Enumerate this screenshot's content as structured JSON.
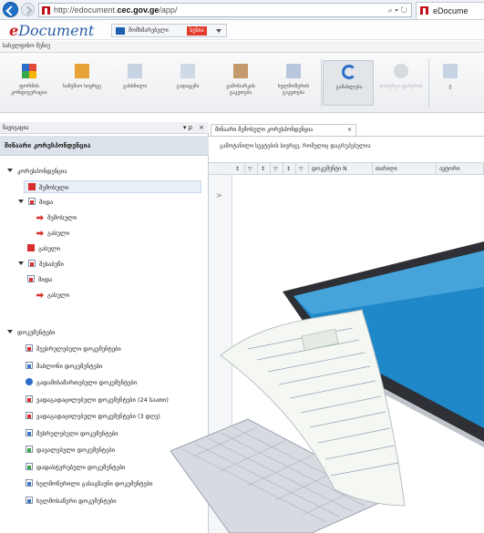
{
  "browser": {
    "url_prefix": "http://edocument.",
    "url_host": "cec.gov.ge",
    "url_suffix": "/app/",
    "tools": "⌕ ▾ ↻",
    "tab_title": "eDocume"
  },
  "app": {
    "logo_e": "e",
    "logo_rest": "Document",
    "language_label": "მომხმარებელი",
    "language_badge": "სესია",
    "menu": "სახელფისო მენიუ"
  },
  "ribbon": [
    {
      "label": "ფორმის კონფიგურაცია",
      "icon": "colored-squares-icon",
      "state": "normal"
    },
    {
      "label": "სამუშაო სივრცე",
      "icon": "inbox-icon",
      "state": "normal"
    },
    {
      "label": "გახსნილი",
      "icon": "document-icon",
      "state": "normal"
    },
    {
      "label": "გადაცემა",
      "icon": "document-forward-icon",
      "state": "normal"
    },
    {
      "label": "გამოსარკის გაკეთება",
      "icon": "document-print-icon",
      "state": "normal"
    },
    {
      "label": "ხელმოწერის გაკეთება",
      "icon": "document-sign-icon",
      "state": "normal"
    },
    {
      "label": "განახლება",
      "icon": "refresh-icon",
      "state": "selected"
    },
    {
      "label": "დახურვა ფანჯრის",
      "icon": "close-window-icon",
      "state": "disabled"
    },
    {
      "label": "გ",
      "icon": "document-icon",
      "state": "normal"
    }
  ],
  "left_panel": {
    "header": "ნავიგაცია",
    "pin": "▾ ρ",
    "close": "×",
    "title": "შინაარი კორესპონდენცია",
    "tree": [
      {
        "label": "კორესპონდენცია",
        "level": 0,
        "icon": "triangle",
        "name": "tree-correspondence"
      },
      {
        "label": "შემოსული",
        "level": 2,
        "icon": "red-square",
        "name": "tree-incoming",
        "selected": true
      },
      {
        "label": "შიდა",
        "level": 1,
        "icon": "doc-red",
        "name": "tree-internal"
      },
      {
        "label": "შემოსული",
        "level": 3,
        "icon": "red-arrow",
        "name": "tree-internal-incoming"
      },
      {
        "label": "გასული",
        "level": 3,
        "icon": "red-arrow",
        "name": "tree-internal-outgoing"
      },
      {
        "label": "გასული",
        "level": 2,
        "icon": "red-square",
        "name": "tree-outgoing"
      },
      {
        "label": "შესაბუწი",
        "level": 1,
        "icon": "doc-red",
        "name": "tree-branch"
      },
      {
        "label": "შიდა",
        "level": 2,
        "icon": "doc-red",
        "name": "tree-branch-internal"
      },
      {
        "label": "გასული",
        "level": 3,
        "icon": "red-arrow",
        "name": "tree-branch-outgoing"
      }
    ],
    "docs_header": "დოკუმენტები",
    "docs": [
      {
        "label": "შეუსრულებელი დოკუმენტები",
        "icon": "doc-red"
      },
      {
        "label": "შაბლონი დოკუმენტები",
        "icon": "doc-blue"
      },
      {
        "label": "გადამისამართებული დოკუმენტები",
        "icon": "circle-blue"
      },
      {
        "label": "ვადაგადაცილებული დოკუმენტები (24 საათი)",
        "icon": "doc-red"
      },
      {
        "label": "ვადაგადაცილებული დოკუმენტები (3 დღე)",
        "icon": "doc-red"
      },
      {
        "label": "შესრულებული დოკუმენტები",
        "icon": "doc-blue"
      },
      {
        "label": "დავალებული დოკუმენტები",
        "icon": "doc-green"
      },
      {
        "label": "დადასტურებული დოკუმენტები",
        "icon": "doc-green"
      },
      {
        "label": "ხელმოწერილი გასაგზავნი დოკუმენტები",
        "icon": "doc-blue"
      },
      {
        "label": "ხელმოსაწერი დოკუმენტები",
        "icon": "doc-blue"
      }
    ]
  },
  "right_panel": {
    "tab": "შინაარი შემოსული კორესპონდენცია",
    "tab_close": "×",
    "info": "გამოტანილი სვეტების სივრცე, რომელიც დაგრუპებულია",
    "columns": [
      "↕",
      "▽",
      "↕",
      "▽",
      "↕",
      "▽",
      "დოკუმენტი N",
      "თარიღი",
      "ავტორი"
    ],
    "side_chevron": ">"
  }
}
